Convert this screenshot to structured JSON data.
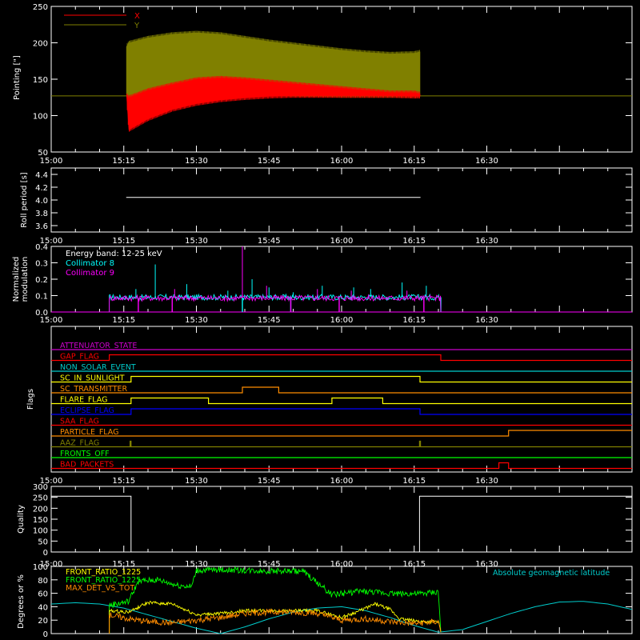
{
  "figure": {
    "background": "#000000",
    "foreground": "#ffffff"
  },
  "time_axis": {
    "tick_labels": [
      "15:00",
      "15:15",
      "15:30",
      "15:45",
      "16:00",
      "16:15",
      "16:30"
    ],
    "range_min": [
      900,
      1020
    ]
  },
  "chart_data": [
    {
      "type": "line",
      "id": "pointing",
      "ylabel": "Pointing [\"]",
      "ylim": [
        50,
        250
      ],
      "yticks": [
        50,
        100,
        150,
        200,
        250
      ],
      "grid": false,
      "legend": {
        "placement": "top-left",
        "entries": [
          {
            "name": "X",
            "color": "#ff0000"
          },
          {
            "name": "Y",
            "color": "#808000"
          }
        ]
      },
      "baseline": {
        "value": 127,
        "color": "#808000"
      },
      "segment": [
        915.5,
        976.3
      ],
      "series": [
        {
          "name": "X",
          "color": "#ff0000",
          "envelope": {
            "t": [
              915.5,
              916,
              920,
              925,
              930,
              935,
              940,
              945,
              950,
              955,
              960,
              965,
              970,
              975,
              976.3
            ],
            "low": [
              130,
              80,
              95,
              108,
              116,
              121,
              124,
              126,
              127,
              127,
              127,
              127,
              127,
              126,
              126
            ],
            "high": [
              130,
              125,
              135,
              143,
              150,
              152,
              150,
              147,
              144,
              141,
              138,
              135,
              132,
              132,
              130
            ]
          }
        },
        {
          "name": "Y",
          "color": "#808000",
          "envelope": {
            "t": [
              915.5,
              916,
              920,
              925,
              930,
              935,
              940,
              945,
              950,
              955,
              960,
              965,
              970,
              975,
              976.3
            ],
            "low": [
              130,
              113,
              122,
              127,
              131,
              132,
              131,
              130,
              129,
              128,
              127,
              127,
              127,
              127,
              127
            ],
            "high": [
              195,
              200,
              207,
              212,
              214,
              212,
              207,
              202,
              198,
              194,
              190,
              187,
              185,
              186,
              188
            ]
          }
        }
      ]
    },
    {
      "type": "line",
      "id": "roll_period",
      "ylabel": "Roll period [s]",
      "ylim": [
        3.5,
        4.5
      ],
      "yticks": [
        3.6,
        3.8,
        4.0,
        4.2,
        4.4
      ],
      "grid": false,
      "series": [
        {
          "name": "",
          "color": "#ffffff",
          "x": [
            915.5,
            976.3
          ],
          "y": [
            4.04,
            4.04
          ]
        }
      ]
    },
    {
      "type": "line",
      "id": "modulation",
      "ylabel": "Normalized modulation",
      "ylim": [
        0,
        0.4
      ],
      "yticks": [
        0.0,
        0.1,
        0.2,
        0.3,
        0.4
      ],
      "grid": false,
      "annotation": "Energy band: 12-25 keV",
      "legend": {
        "placement": "top-left",
        "entries": [
          {
            "name": "Collimator 8",
            "color": "#00ffff"
          },
          {
            "name": "Collimator 9",
            "color": "#ff00ff"
          }
        ]
      },
      "series": [
        {
          "name": "Collimator 8",
          "color": "#00ffff",
          "segment": [
            912,
            980.5
          ],
          "level": 0.09,
          "spikes": [
            [
              917.5,
              0.14
            ],
            [
              921.5,
              0.29
            ],
            [
              928,
              0.17
            ],
            [
              936.5,
              0.13
            ],
            [
              941.5,
              0.2
            ],
            [
              945,
              0.15
            ],
            [
              950,
              0.12
            ],
            [
              956,
              0.16
            ],
            [
              962.5,
              0.15
            ],
            [
              966,
              0.14
            ],
            [
              972.5,
              0.18
            ],
            [
              977.5,
              0.16
            ]
          ],
          "drops": [
            [
              939.5,
              0
            ],
            [
              949.5,
              0
            ],
            [
              980.5,
              0
            ]
          ]
        },
        {
          "name": "Collimator 9",
          "color": "#ff00ff",
          "segment": [
            912,
            980.5
          ],
          "level": 0.085,
          "spikes": [
            [
              925.5,
              0.14
            ],
            [
              939.5,
              0.4
            ],
            [
              944.5,
              0.16
            ],
            [
              955,
              0.14
            ],
            [
              962,
              0.13
            ],
            [
              973.5,
              0.13
            ]
          ],
          "drops": [
            [
              918,
              0
            ],
            [
              925,
              0
            ],
            [
              949.5,
              0
            ],
            [
              959.5,
              0
            ],
            [
              977,
              0
            ]
          ]
        }
      ]
    },
    {
      "type": "step",
      "id": "flags",
      "ylabel": "Flags",
      "grid": false,
      "flags": [
        {
          "name": "ATTENUATOR_STATE",
          "color": "#cc00cc",
          "steps": []
        },
        {
          "name": "GAP_FLAG",
          "color": "#ff0000",
          "steps": [
            [
              912,
              1
            ],
            [
              980.5,
              0
            ]
          ]
        },
        {
          "name": "NON_SOLAR_EVENT",
          "color": "#00cccc",
          "steps": []
        },
        {
          "name": "SC_IN_SUNLIGHT",
          "color": "#ffff00",
          "steps": [
            [
              916.5,
              1
            ],
            [
              976.2,
              0
            ]
          ]
        },
        {
          "name": "SC_TRANSMITTER",
          "color": "#ff8c00",
          "steps": [
            [
              939.5,
              1
            ],
            [
              947,
              0
            ]
          ]
        },
        {
          "name": "FLARE_FLAG",
          "color": "#ffff00",
          "steps": [
            [
              916.5,
              1
            ],
            [
              932.5,
              0
            ],
            [
              958,
              1
            ],
            [
              968.5,
              0
            ]
          ]
        },
        {
          "name": "ECLIPSE_FLAG",
          "color": "#0000ff",
          "steps": [
            [
              916.5,
              1
            ],
            [
              976.2,
              0
            ]
          ]
        },
        {
          "name": "SAA_FLAG",
          "color": "#ff0000",
          "steps": []
        },
        {
          "name": "PARTICLE_FLAG",
          "color": "#ff8c00",
          "steps": [
            [
              994.5,
              1
            ]
          ]
        },
        {
          "name": "AAZ_FLAG",
          "color": "#808000",
          "steps": [
            [
              916.3,
              1
            ],
            [
              916.5,
              0
            ],
            [
              976.1,
              1
            ],
            [
              976.3,
              0
            ]
          ]
        },
        {
          "name": "FRONTS_OFF",
          "color": "#00ff00",
          "steps": []
        },
        {
          "name": "BAD_PACKETS",
          "color": "#ff0000",
          "steps": [
            [
              992.5,
              1
            ],
            [
              994.5,
              0
            ]
          ]
        }
      ]
    },
    {
      "type": "step",
      "id": "quality",
      "ylabel": "Quality",
      "ylim": [
        0,
        300
      ],
      "yticks": [
        0,
        50,
        100,
        150,
        200,
        250,
        300
      ],
      "grid": false,
      "series": [
        {
          "name": "",
          "color": "#ffffff",
          "x": [
            900,
            916.5,
            916.5,
            976.1,
            976.1,
            1020
          ],
          "y": [
            255,
            255,
            0,
            0,
            255,
            255
          ]
        }
      ]
    },
    {
      "type": "line",
      "id": "front_ratio",
      "ylabel": "Degrees or %",
      "ylim": [
        0,
        100
      ],
      "yticks": [
        0,
        20,
        40,
        60,
        80,
        100
      ],
      "grid": false,
      "legend": {
        "placement": "top-left",
        "entries": [
          {
            "name": "FRONT_RATIO_1225",
            "color": "#ffff00"
          },
          {
            "name": "FRONT_RATIO_1225",
            "color": "#00ff00"
          },
          {
            "name": "MAX_DET_VS_TOT",
            "color": "#ff8c00"
          }
        ]
      },
      "right_legend": {
        "name": "Absolute geomagnetic latitude",
        "color": "#00cccc"
      },
      "series": [
        {
          "name": "Absolute geomagnetic latitude",
          "color": "#00cccc",
          "x": [
            900,
            905,
            910,
            915,
            920,
            925,
            930,
            935,
            940,
            945,
            950,
            955,
            960,
            965,
            970,
            975,
            980,
            985,
            990,
            995,
            1000,
            1005,
            1010,
            1015,
            1020
          ],
          "y": [
            44,
            46,
            44,
            38,
            28,
            18,
            8,
            0,
            10,
            22,
            32,
            38,
            40,
            34,
            24,
            12,
            2,
            6,
            18,
            30,
            40,
            47,
            48,
            44,
            36
          ]
        },
        {
          "name": "FRONT_RATIO_1225",
          "color": "#00ff00",
          "x": [
            912,
            916,
            918,
            922,
            926,
            929,
            930,
            935,
            941,
            946,
            952,
            958,
            964,
            970,
            976,
            980,
            980.5
          ],
          "y": [
            42,
            48,
            78,
            80,
            72,
            70,
            94,
            95,
            94,
            93,
            93,
            58,
            63,
            60,
            59,
            62,
            2
          ]
        },
        {
          "name": "FRONT_RATIO_1225",
          "color": "#ffff00",
          "x": [
            912,
            916,
            920,
            925,
            930,
            935,
            940,
            945,
            950,
            955,
            960,
            963,
            967,
            970,
            972,
            976,
            980,
            980.5
          ],
          "y": [
            34,
            32,
            46,
            44,
            28,
            30,
            34,
            34,
            34,
            34,
            24,
            32,
            44,
            36,
            22,
            18,
            18,
            2
          ]
        },
        {
          "name": "MAX_DET_VS_TOT",
          "color": "#ff8c00",
          "x": [
            912,
            916,
            920,
            925,
            930,
            935,
            940,
            945,
            950,
            955,
            960,
            965,
            970,
            975,
            980,
            980.5
          ],
          "y": [
            28,
            22,
            18,
            16,
            20,
            24,
            30,
            32,
            32,
            30,
            20,
            22,
            18,
            15,
            18,
            2
          ]
        }
      ]
    }
  ]
}
